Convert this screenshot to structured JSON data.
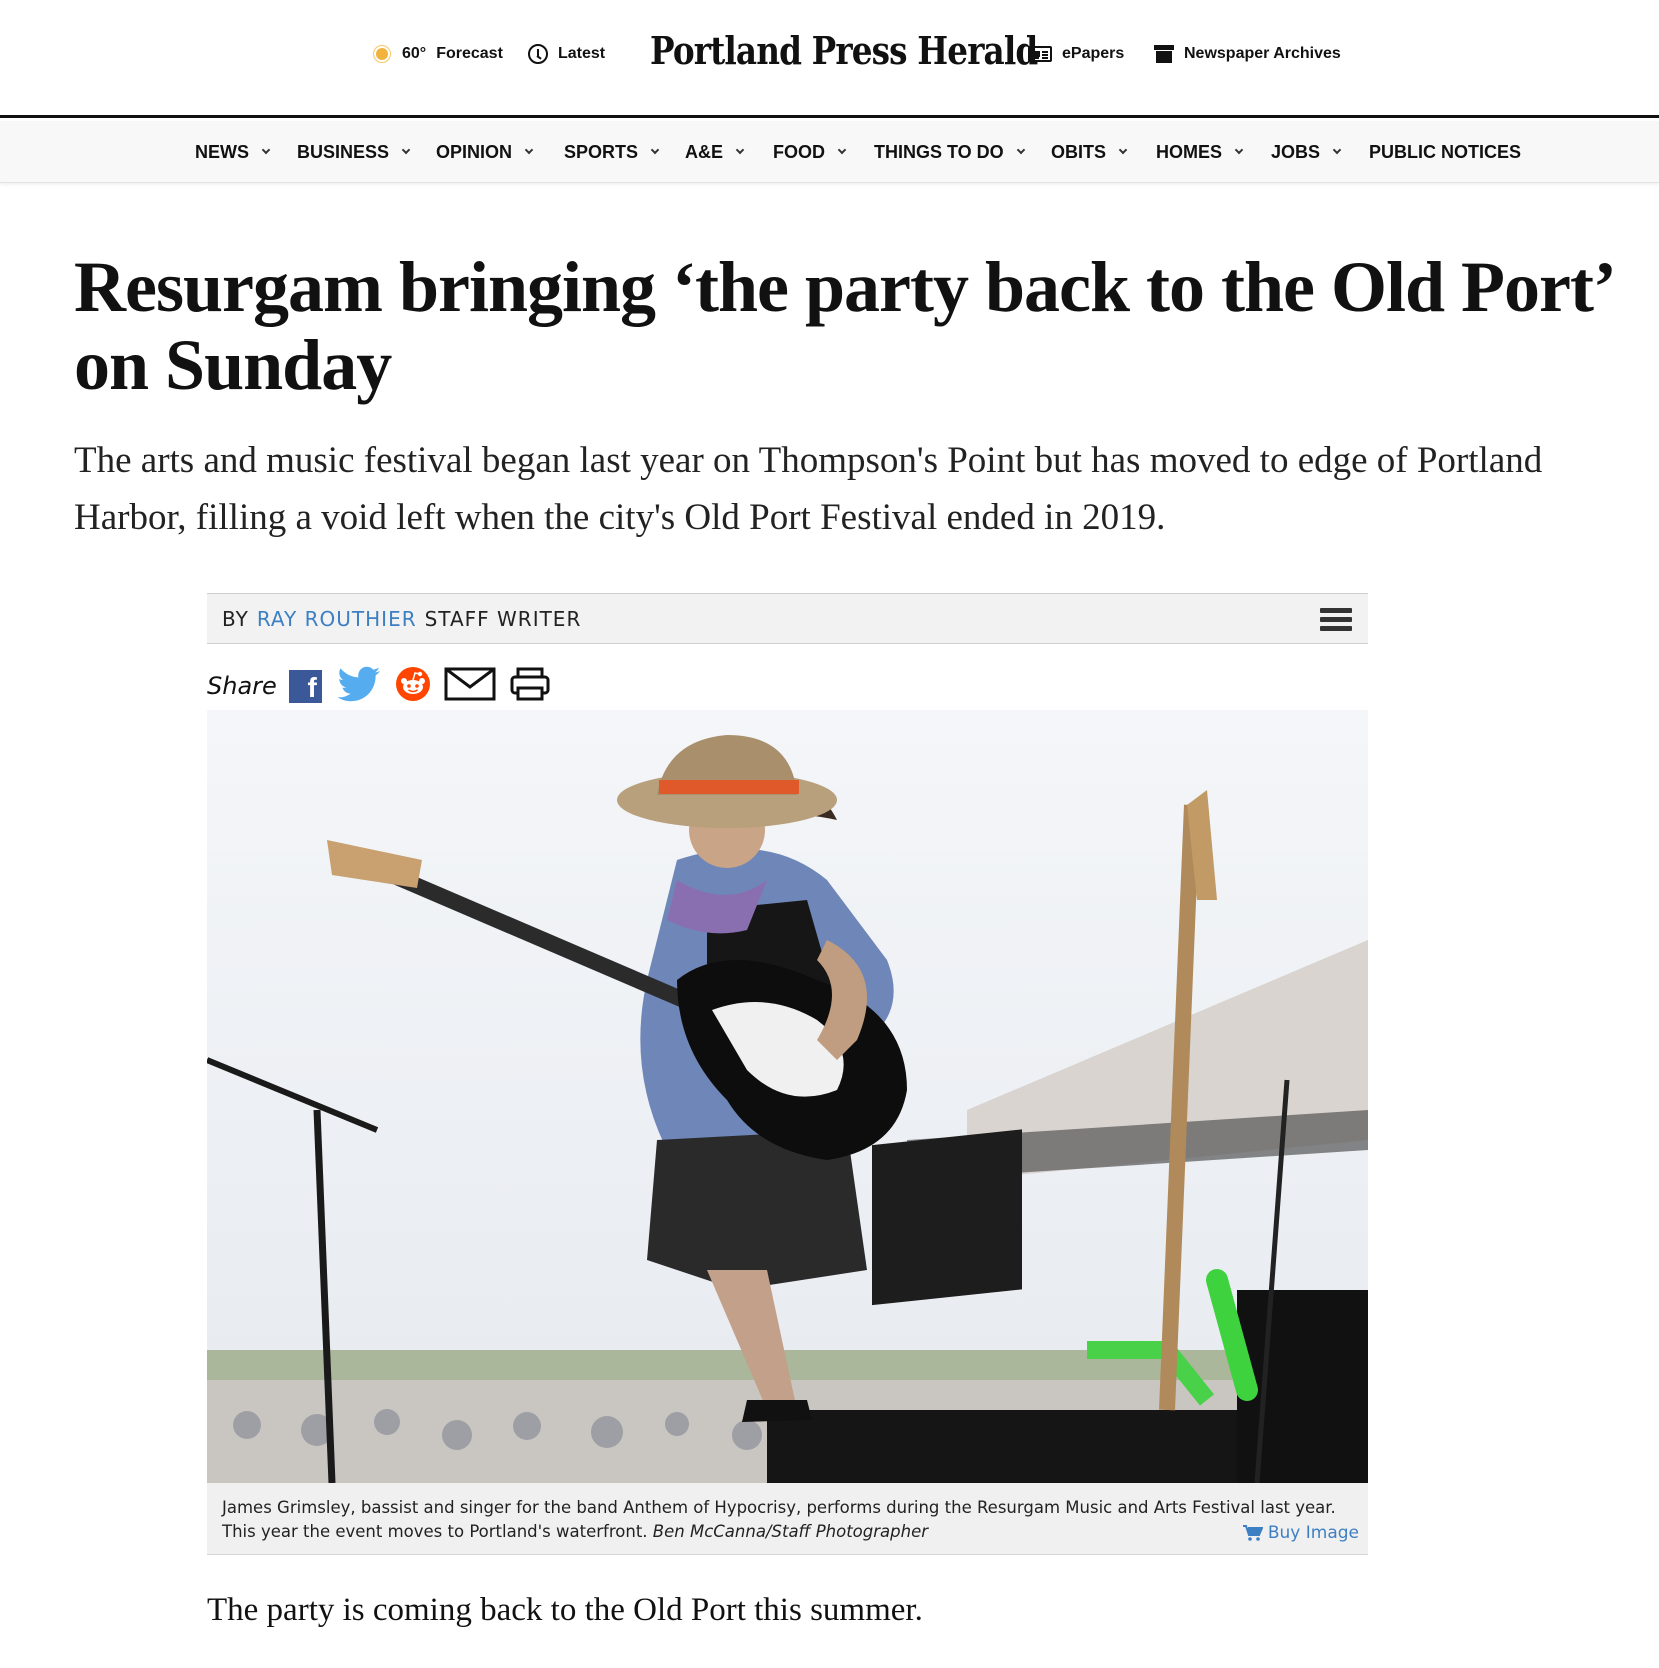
{
  "header": {
    "weather_temp": "60°",
    "weather_label": "Forecast",
    "latest_label": "Latest",
    "logo_text": "Portland Press Herald",
    "epapers_label": "ePapers",
    "archives_label": "Newspaper Archives"
  },
  "nav": {
    "items": [
      {
        "label": "NEWS"
      },
      {
        "label": "BUSINESS"
      },
      {
        "label": "OPINION"
      },
      {
        "label": "SPORTS"
      },
      {
        "label": "A&E"
      },
      {
        "label": "FOOD"
      },
      {
        "label": "THINGS TO DO"
      },
      {
        "label": "OBITS"
      },
      {
        "label": "HOMES"
      },
      {
        "label": "JOBS"
      },
      {
        "label": "PUBLIC NOTICES"
      }
    ]
  },
  "article": {
    "headline": "Resurgam bringing ‘the party back to the Old Port’ on Sunday",
    "dek": "The arts and music festival began last year on Thompson's Point but has moved to edge of Portland Harbor, filling a void left when the city's Old Port Festival ended in 2019.",
    "byline_prefix": "BY",
    "author": "RAY ROUTHIER",
    "author_title": "STAFF WRITER",
    "share_label": "Share",
    "caption_text": "James Grimsley, bassist and singer for the band Anthem of Hypocrisy, performs during the Resurgam Music and Arts Festival last year. This year the event moves to Portland's waterfront.",
    "caption_credit": "Ben McCanna/Staff Photographer",
    "buy_image_label": "Buy Image",
    "first_paragraph": "The party is coming back to the Old Port this summer."
  },
  "colors": {
    "link_blue": "#3d7fc3",
    "facebook_blue": "#3b5898",
    "twitter_blue": "#55acee",
    "reddit_orange": "#ff4500"
  },
  "icons": [
    "sun-icon",
    "clock-icon",
    "epaper-icon",
    "archive-box-icon",
    "chevron-down-icon",
    "hamburger-menu-icon",
    "facebook-icon",
    "twitter-icon",
    "reddit-icon",
    "email-icon",
    "print-icon",
    "cart-icon"
  ]
}
